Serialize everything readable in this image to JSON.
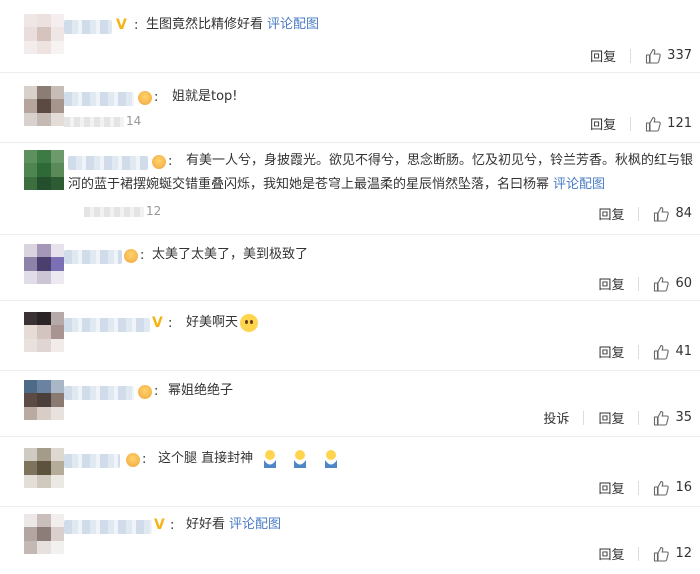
{
  "comments": [
    {
      "text": "生图竟然比精修好看",
      "link": "评论配图",
      "meta": "",
      "actions": {
        "reply": "回复",
        "likes": "337"
      }
    },
    {
      "text": "姐就是top!",
      "link": "",
      "meta": "14",
      "actions": {
        "reply": "回复",
        "likes": "121"
      }
    },
    {
      "text_line1": "有美一人兮，身披霞光。欲见不得兮，思念断肠。忆及初见兮，铃兰芳香。秋枫的红与银",
      "text_line2": "河的蓝于裙摆婉蜒交错重叠闪烁，我知她是苍穹上最温柔的星辰悄然坠落，名曰杨幂",
      "link": "评论配图",
      "meta": "12",
      "actions": {
        "reply": "回复",
        "likes": "84"
      }
    },
    {
      "text": "太美了太美了，美到极致了",
      "link": "",
      "meta": "",
      "actions": {
        "reply": "回复",
        "likes": "60"
      }
    },
    {
      "text": "好美啊天",
      "link": "",
      "meta": "",
      "actions": {
        "reply": "回复",
        "likes": "41"
      }
    },
    {
      "text": "幂姐绝绝子",
      "link": "",
      "meta": "",
      "actions": {
        "report": "投诉",
        "reply": "回复",
        "likes": "35"
      }
    },
    {
      "text": "这个腿 直接封神",
      "link": "",
      "meta": "",
      "actions": {
        "reply": "回复",
        "likes": "16"
      }
    },
    {
      "text": "好好看",
      "link": "评论配图",
      "meta": "",
      "actions": {
        "reply": "回复",
        "likes": "12"
      }
    }
  ],
  "colors": {
    "link": "#4a7bc4",
    "verified": "#f3b414",
    "text": "#333333",
    "divider": "#ececec"
  },
  "icons": {
    "like": "thumbs-up-icon",
    "verified": "verified-v-icon",
    "sad_emoji": "sad-face-emoji",
    "pray_emoji": "praying-emoji"
  }
}
